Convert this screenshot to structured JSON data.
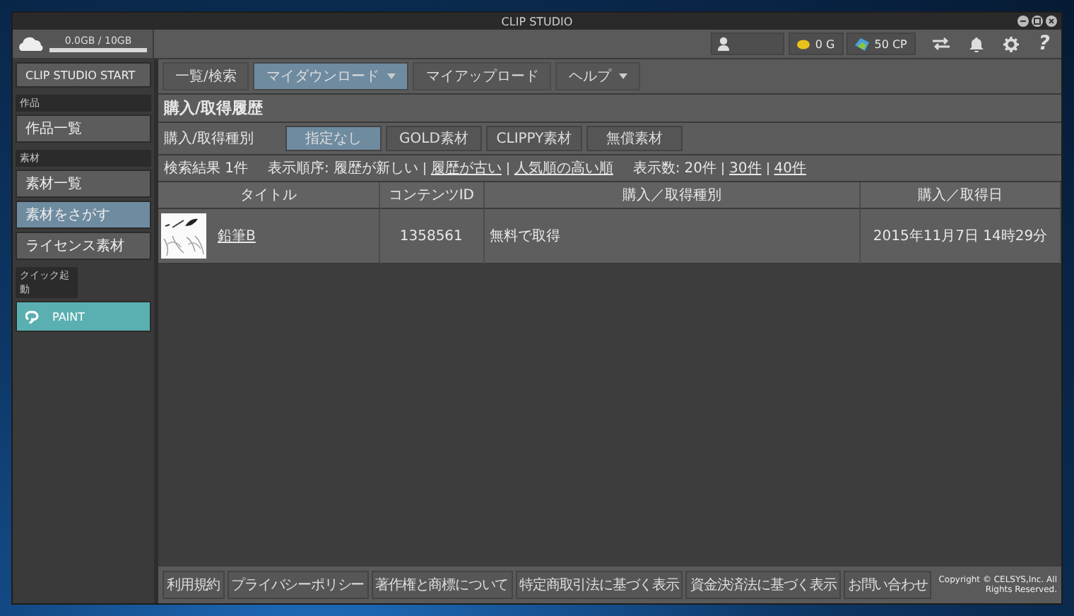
{
  "window": {
    "title": "CLIP STUDIO"
  },
  "top_bar": {
    "storage": {
      "text": "0.0GB / 10GB",
      "level": 0
    },
    "gold": "0 G",
    "cp": "50 CP",
    "help": "?"
  },
  "sidebar": {
    "start": "CLIP STUDIO START",
    "groups": [
      {
        "heading": "作品",
        "items": [
          {
            "label": "作品一覧",
            "selected": false
          }
        ]
      },
      {
        "heading": "素材",
        "items": [
          {
            "label": "素材一覧",
            "selected": false
          },
          {
            "label": "素材をさがす",
            "selected": true
          },
          {
            "label": "ライセンス素材",
            "selected": false
          }
        ]
      }
    ],
    "quick_launch": {
      "heading": "クイック起動",
      "app": "PAINT"
    }
  },
  "tabs": [
    {
      "label": "一覧/検索",
      "selected": false,
      "has_menu": false
    },
    {
      "label": "マイダウンロード",
      "selected": true,
      "has_menu": true
    },
    {
      "label": "マイアップロード",
      "selected": false,
      "has_menu": false
    },
    {
      "label": "ヘルプ",
      "selected": false,
      "has_menu": true
    }
  ],
  "heading": "購入/取得履歴",
  "filter": {
    "label": "購入/取得種別",
    "options": [
      {
        "label": "指定なし",
        "selected": true
      },
      {
        "label": "GOLD素材",
        "selected": false
      },
      {
        "label": "CLIPPY素材",
        "selected": false
      },
      {
        "label": "無償素材",
        "selected": false
      }
    ]
  },
  "results": {
    "count": "検索結果 1件",
    "sort_label": "表示順序:",
    "sort": [
      {
        "label": "履歴が新しい",
        "selected": true
      },
      {
        "label": "履歴が古い",
        "selected": false
      },
      {
        "label": "人気順の高い順",
        "selected": false
      }
    ],
    "size_label": "表示数:",
    "sizes": [
      {
        "label": "20件",
        "selected": true
      },
      {
        "label": "30件",
        "selected": false
      },
      {
        "label": "40件",
        "selected": false
      }
    ]
  },
  "table": {
    "columns": [
      "タイトル",
      "コンテンツID",
      "購入／取得種別",
      "購入／取得日"
    ],
    "rows": [
      {
        "title": "鉛筆B",
        "content_id": "1358561",
        "type": "無料で取得",
        "date": "2015年11月7日 14時29分"
      }
    ]
  },
  "footer": {
    "links": [
      "利用規約",
      "プライバシーポリシー",
      "著作権と商標について",
      "特定商取引法に基づく表示",
      "資金決済法に基づく表示",
      "お問い合わせ"
    ],
    "copyright": "Copyright © CELSYS,Inc. All Rights Reserved."
  }
}
